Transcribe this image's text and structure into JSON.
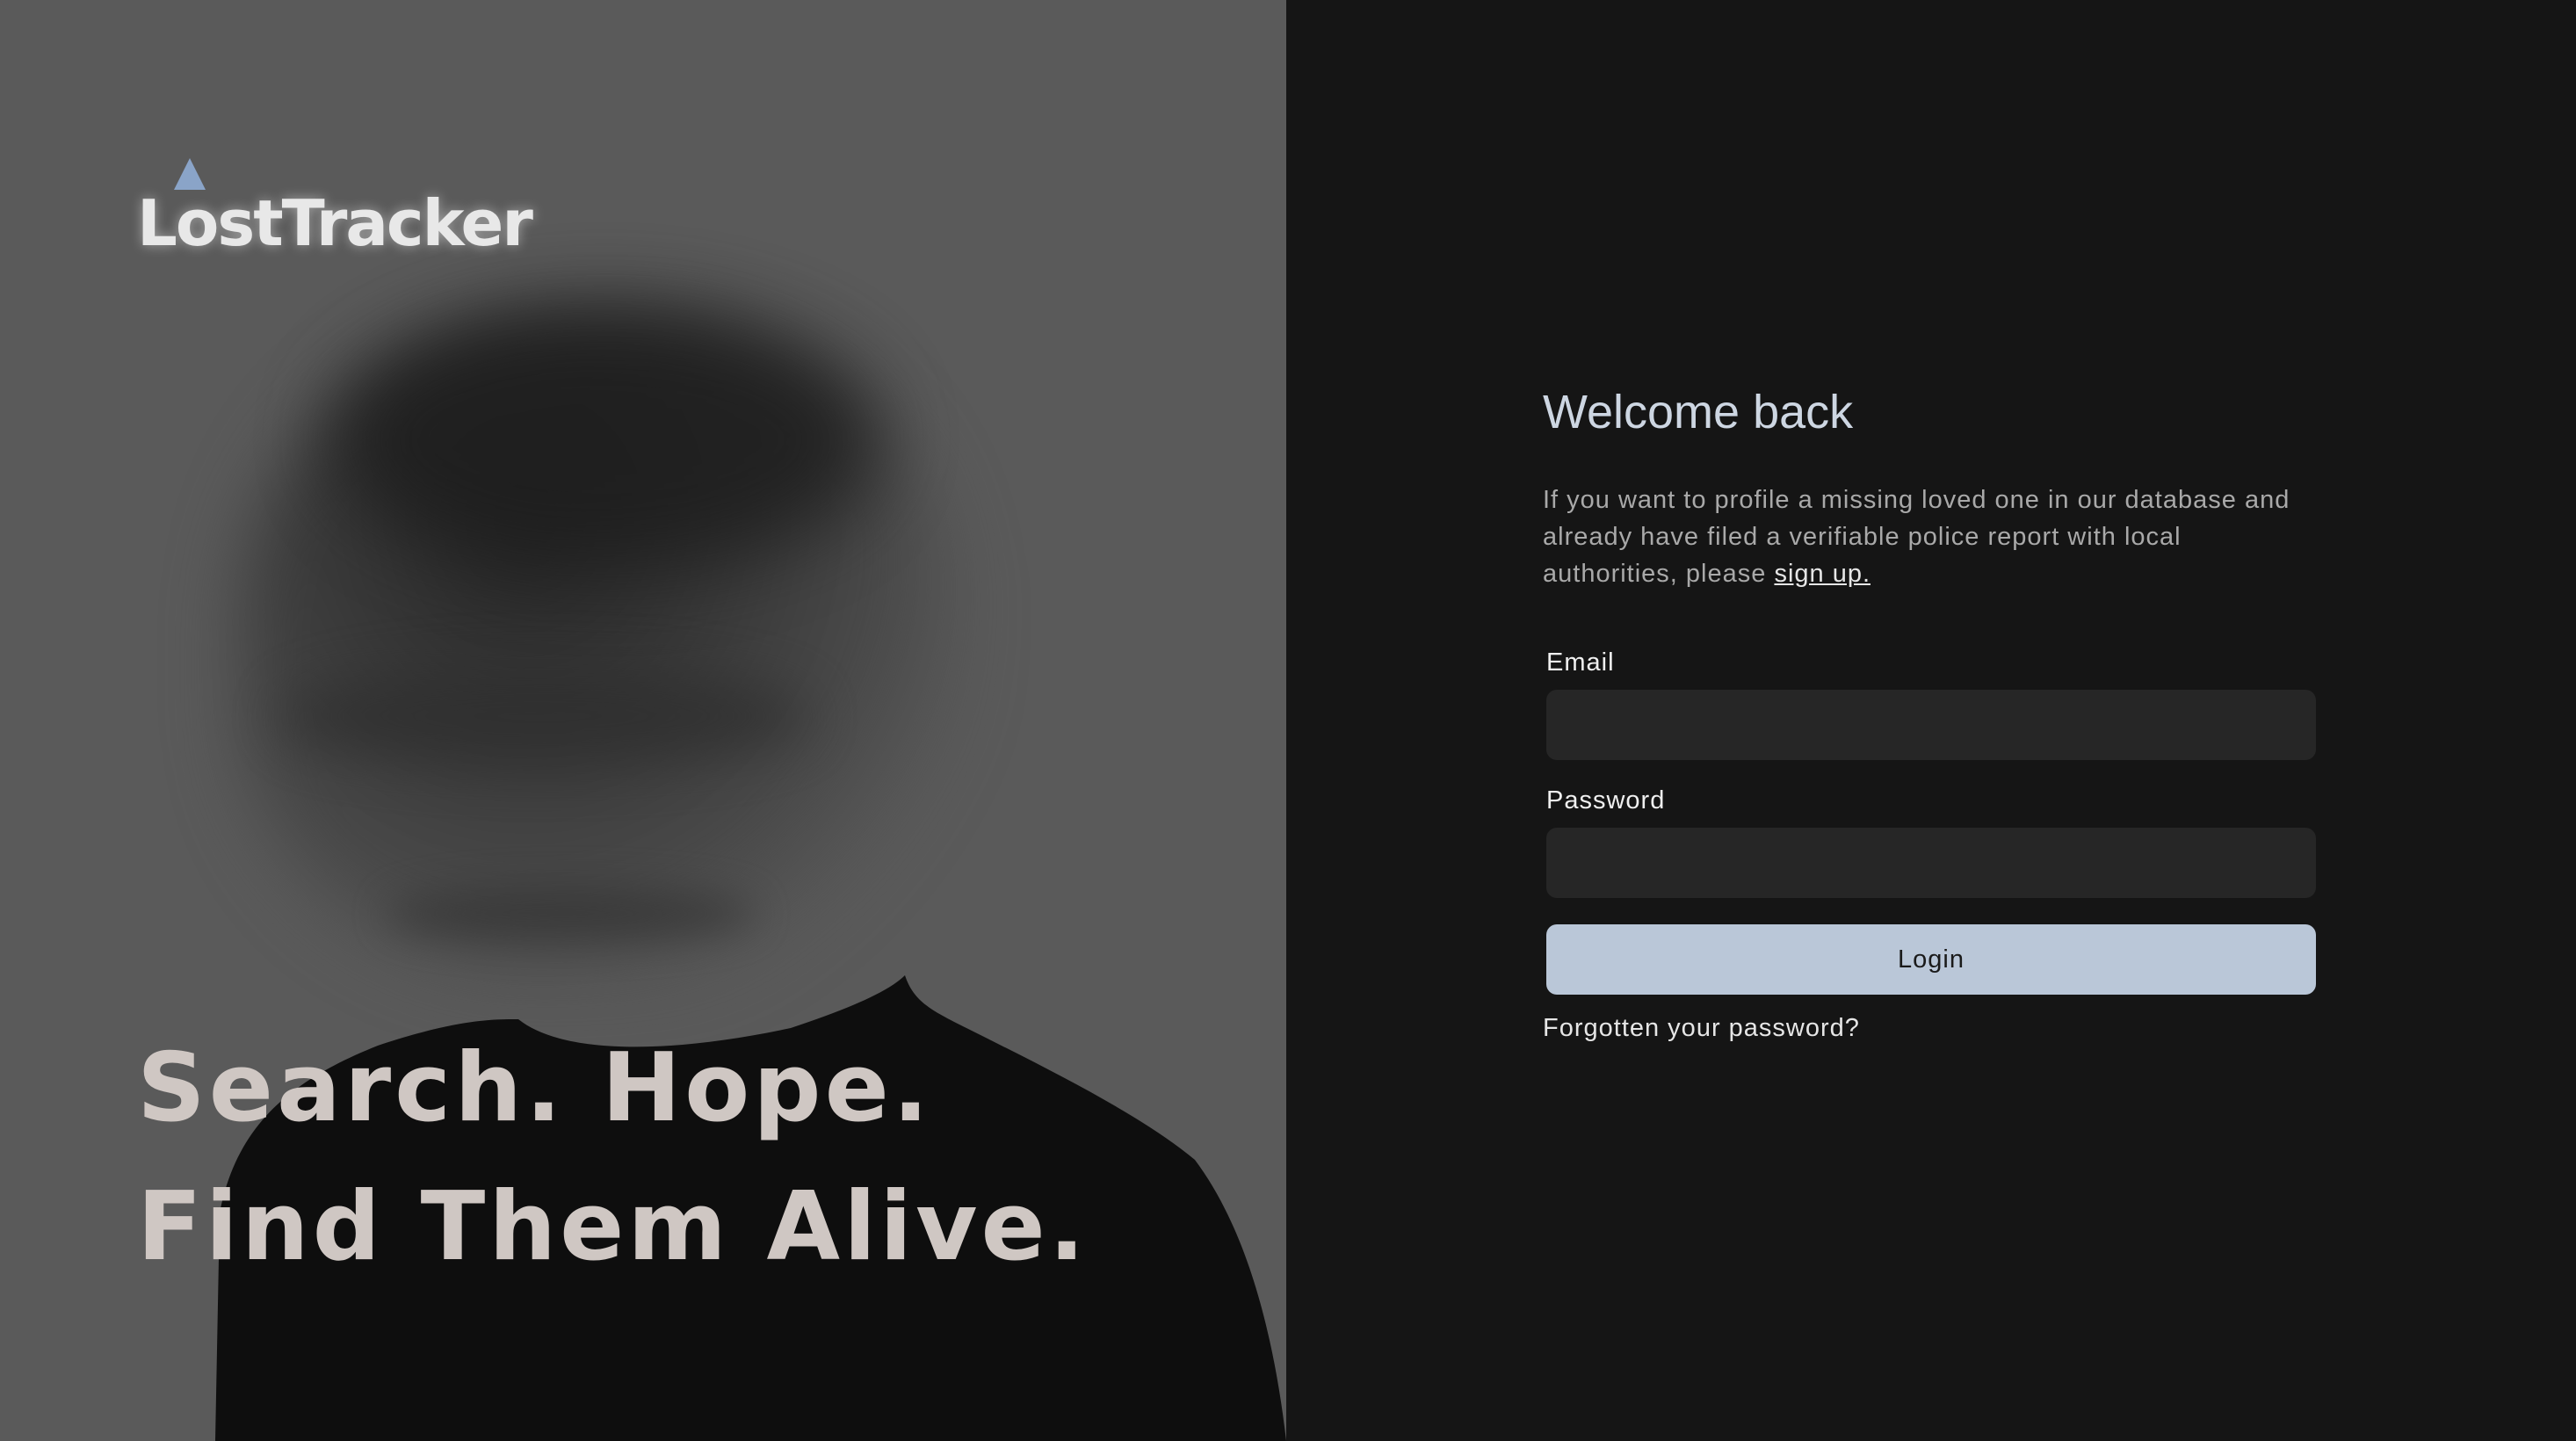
{
  "brand": {
    "name": "LostTracker"
  },
  "hero": {
    "tagline_line1": "Search. Hope.",
    "tagline_line2": "Find Them Alive."
  },
  "login": {
    "title": "Welcome back",
    "intro_text": "If you want to profile a missing loved one in our database and already have filed a verifiable police report with local authorities, please ",
    "signup_link": "sign up.",
    "email_label": "Email",
    "email_value": "",
    "password_label": "Password",
    "password_value": "",
    "login_button": "Login",
    "forgot_link": "Forgotten your password?"
  },
  "colors": {
    "accent": "#bac7d8",
    "logo_mark": "#8aa4c8",
    "panel_bg": "#151515",
    "input_bg": "#262626"
  }
}
